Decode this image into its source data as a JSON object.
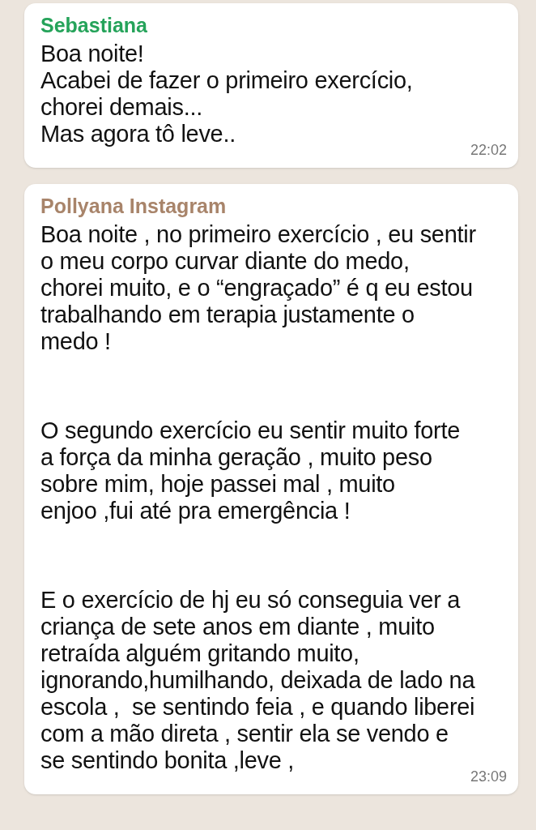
{
  "messages": [
    {
      "sender": "Sebastiana",
      "color": "#25a35a",
      "paragraphs": [
        "Boa noite!\nAcabei de fazer o primeiro exercício,\nchorei demais...\nMas agora tô leve.."
      ],
      "time": "22:02"
    },
    {
      "sender": "Pollyana Instagram",
      "color": "#a8846a",
      "paragraphs": [
        "Boa noite , no primeiro exercício , eu sentir\no meu corpo curvar diante do medo,\nchorei muito, e o “engraçado” é q eu estou\ntrabalhando em terapia justamente o\nmedo !",
        "O segundo exercício eu sentir muito forte\na força da minha geração , muito peso\nsobre mim, hoje passei mal , muito\nenjoo ,fui até pra emergência !",
        "E o exercício de hj eu só conseguia ver a\ncriança de sete anos em diante , muito\nretraída alguém gritando muito,\nignorando,humilhando, deixada de lado na\nescola ,  se sentindo feia , e quando liberei\ncom a mão direta , sentir ela se vendo e\nse sentindo bonita ,leve ,"
      ],
      "time": "23:09"
    }
  ]
}
